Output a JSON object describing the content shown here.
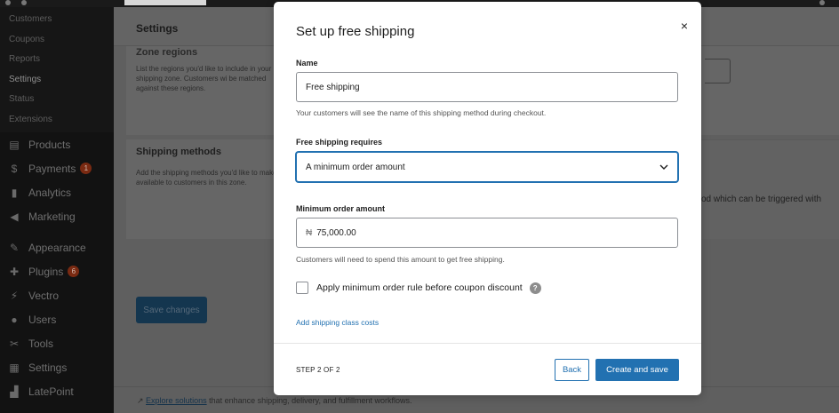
{
  "sidebar": {
    "submenu": [
      "Customers",
      "Coupons",
      "Reports",
      "Settings",
      "Status",
      "Extensions"
    ],
    "current_submenu": "Settings",
    "items": [
      {
        "label": "Products",
        "icon": "products-icon",
        "glyph": "▤"
      },
      {
        "label": "Payments",
        "icon": "payments-icon",
        "glyph": "$",
        "badge": "1"
      },
      {
        "label": "Analytics",
        "icon": "analytics-icon",
        "glyph": "▮"
      },
      {
        "label": "Marketing",
        "icon": "marketing-icon",
        "glyph": "◀"
      },
      {
        "label": "Appearance",
        "icon": "appearance-icon",
        "glyph": "✎"
      },
      {
        "label": "Plugins",
        "icon": "plugins-icon",
        "glyph": "✚",
        "badge": "6"
      },
      {
        "label": "Vectro",
        "icon": "vectro-icon",
        "glyph": "⚡"
      },
      {
        "label": "Users",
        "icon": "users-icon",
        "glyph": "●"
      },
      {
        "label": "Tools",
        "icon": "tools-icon",
        "glyph": "✂"
      },
      {
        "label": "Settings",
        "icon": "settings-icon",
        "glyph": "▦"
      },
      {
        "label": "LatePoint",
        "icon": "latepoint-icon",
        "glyph": "▟"
      }
    ]
  },
  "page": {
    "title": "Settings",
    "zone_regions_title": "Zone regions",
    "zone_regions_desc": "List the regions you'd like to include in your shipping zone. Customers wi be matched against these regions.",
    "shipping_methods_title": "Shipping methods",
    "shipping_methods_desc": "Add the shipping methods you'd like to make available to customers in this zone.",
    "methods_cut_text": "od which can be triggered with",
    "save_button": "Save changes",
    "footer_link": "Explore solutions",
    "footer_text": " that enhance shipping, delivery, and fulfillment workflows."
  },
  "modal": {
    "title": "Set up free shipping",
    "close_glyph": "×",
    "name_label": "Name",
    "name_value": "Free shipping",
    "name_help": "Your customers will see the name of this shipping method during checkout.",
    "requires_label": "Free shipping requires",
    "requires_value": "A minimum order amount",
    "min_label": "Minimum order amount",
    "currency_symbol": "₦",
    "min_value": "75,000.00",
    "min_help": "Customers will need to spend this amount to get free shipping.",
    "checkbox_label": "Apply minimum order rule before coupon discount",
    "help_glyph": "?",
    "add_class_link": "Add shipping class costs",
    "step_text": "STEP 2 OF 2",
    "back_button": "Back",
    "create_button": "Create and save"
  },
  "colors": {
    "accent": "#2271b1",
    "overlay": "#5f5f5f",
    "badge": "#7a2a12"
  }
}
